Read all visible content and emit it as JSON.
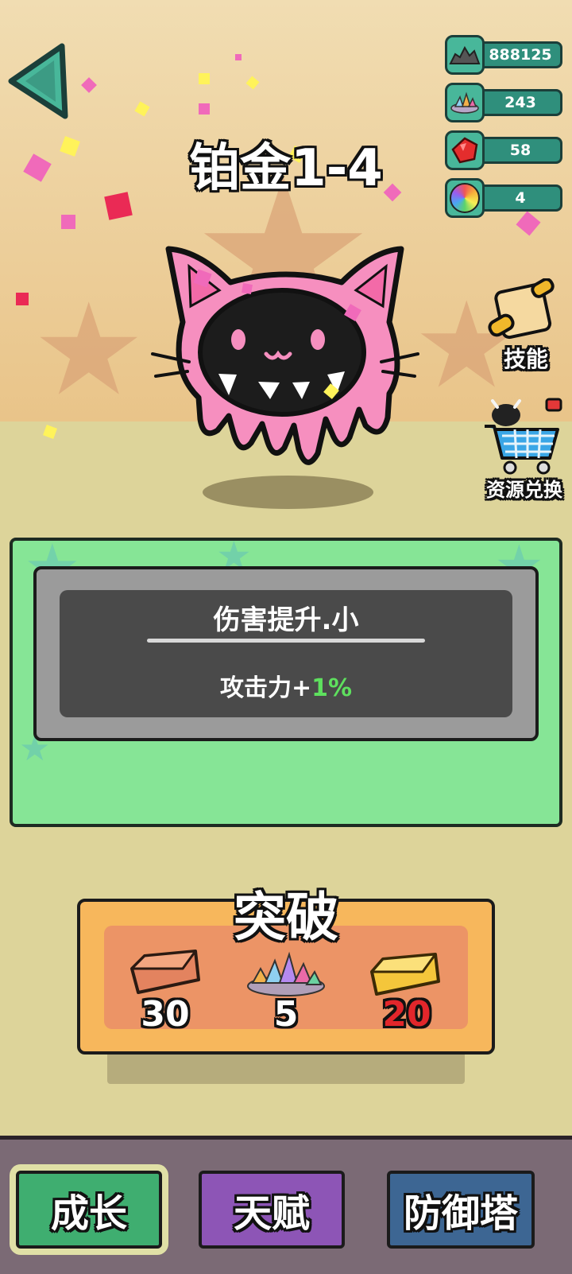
{
  "header": {
    "stage_title": "铂金1-4",
    "back_icon": "back-arrow-icon"
  },
  "resources": [
    {
      "icon": "coal-pile-icon",
      "value": "888125"
    },
    {
      "icon": "crystal-ore-pile-icon",
      "value": "243"
    },
    {
      "icon": "red-gem-icon",
      "value": "58"
    },
    {
      "icon": "rainbow-orb-icon",
      "value": "4"
    }
  ],
  "side_menu": {
    "skills_label": "技能",
    "skills_icon": "scroll-icon",
    "exchange_label": "资源兑换",
    "exchange_icon": "shopping-cart-icon"
  },
  "character": {
    "name_icon": "pink-cat-hood-slime"
  },
  "upgrade_info": {
    "skill_name": "伤害提升.小",
    "effect_prefix": "攻击力+",
    "effect_value": "1%"
  },
  "breakthrough": {
    "title": "突破",
    "costs": [
      {
        "icon": "copper-ingot-icon",
        "amount": "30",
        "color": "#ffffff"
      },
      {
        "icon": "crystal-ore-pile-icon",
        "amount": "5",
        "color": "#ffffff"
      },
      {
        "icon": "gold-ingot-icon",
        "amount": "20",
        "color": "#e2262b"
      }
    ]
  },
  "bottom_nav": {
    "tabs": [
      {
        "label": "成长",
        "active": true
      },
      {
        "label": "天赋",
        "active": false
      },
      {
        "label": "防御塔",
        "active": false
      }
    ]
  }
}
